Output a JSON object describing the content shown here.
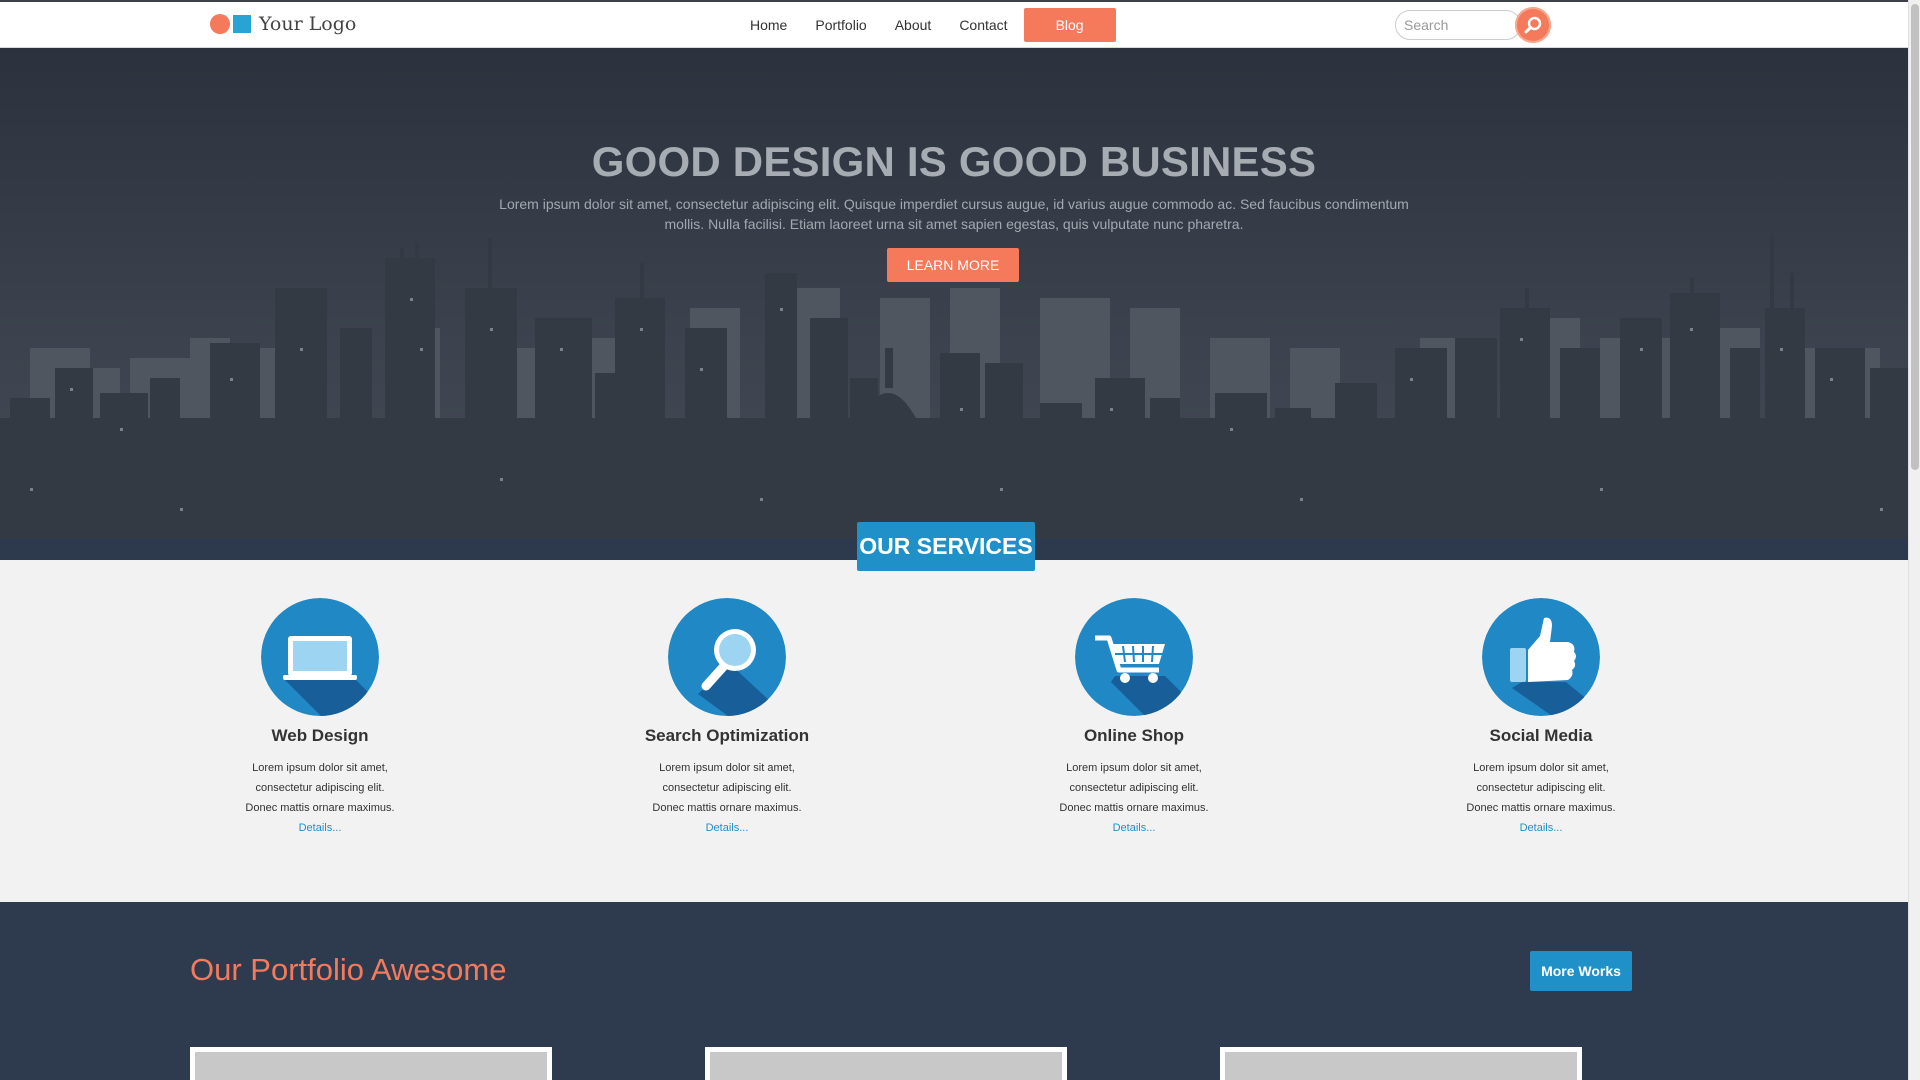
{
  "header": {
    "logo_text": "Your Logo",
    "nav": [
      "Home",
      "Portfolio",
      "About",
      "Contact"
    ],
    "nav_active": "Blog",
    "search_placeholder": "Search"
  },
  "hero": {
    "title": "GOOD DESIGN IS GOOD BUSINESS",
    "text": "Lorem ipsum dolor sit amet, consectetur adipiscing elit. Quisque imperdiet cursus augue, id varius augue commodo ac. Sed faucibus condimentum mollis. Nulla facilisi. Etiam laoreet urna sit amet sapien egestas, quis vulputate nunc pharetra.",
    "button": "LEARN MORE"
  },
  "services": {
    "badge": "OUR SERVICES",
    "items": [
      {
        "title": "Web Design",
        "icon": "laptop-icon",
        "desc": "Lorem ipsum dolor sit amet, consectetur adipiscing elit. Donec mattis ornare maximus.",
        "link": "Details..."
      },
      {
        "title": "Search Optimization",
        "icon": "magnifier-icon",
        "desc": "Lorem ipsum dolor sit amet, consectetur adipiscing elit. Donec mattis ornare maximus.",
        "link": "Details..."
      },
      {
        "title": "Online Shop",
        "icon": "shopping-cart-icon",
        "desc": "Lorem ipsum dolor sit amet, consectetur adipiscing elit. Donec mattis ornare maximus.",
        "link": "Details..."
      },
      {
        "title": "Social Media",
        "icon": "thumbs-up-icon",
        "desc": "Lorem ipsum dolor sit amet, consectetur adipiscing elit. Donec mattis ornare maximus.",
        "link": "Details..."
      }
    ]
  },
  "portfolio": {
    "title": "Our Portfolio Awesome",
    "button": "More Works"
  },
  "colors": {
    "accent_orange": "#f47a5b",
    "accent_blue": "#2090c8",
    "hero_dark": "#2c323d",
    "portfolio_bg": "#2e3b4f"
  }
}
